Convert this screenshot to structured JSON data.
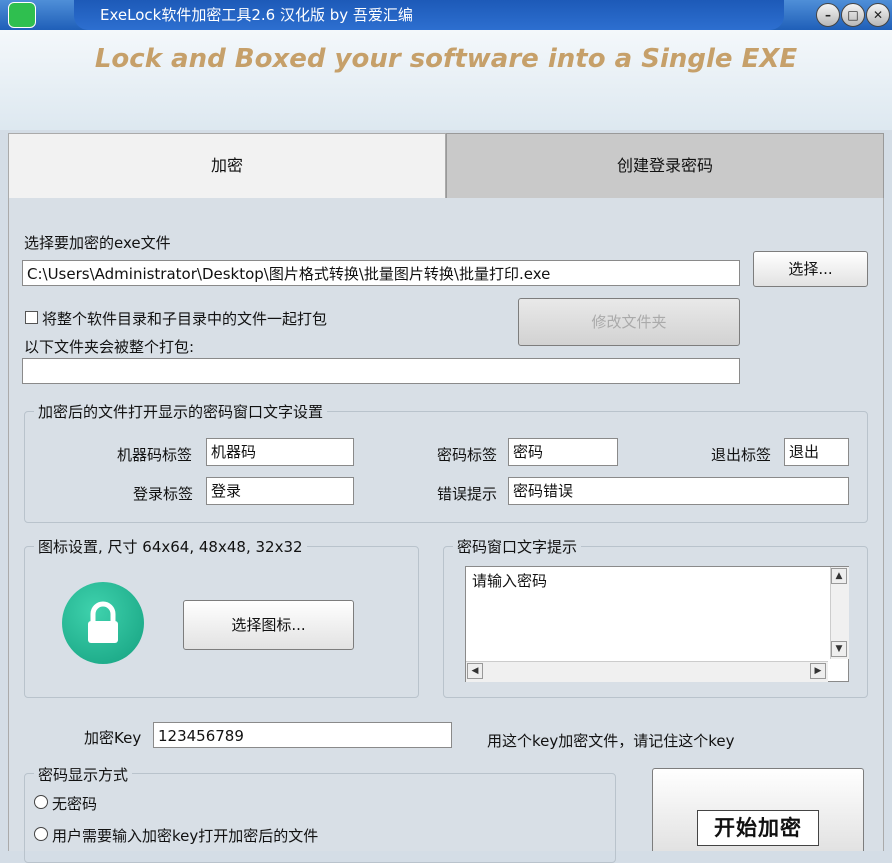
{
  "window": {
    "title": "ExeLock软件加密工具2.6 汉化版 by 吾爱汇编",
    "banner": "Lock and Boxed your software into a Single EXE"
  },
  "tabs": [
    {
      "label": "加密",
      "active": true
    },
    {
      "label": "创建登录密码",
      "active": false
    }
  ],
  "file_section": {
    "label": "选择要加密的exe文件",
    "path_value": "C:\\Users\\Administrator\\Desktop\\图片格式转换\\批量图片转换\\批量打印.exe",
    "browse_label": "选择...",
    "pack_checkbox_label": "将整个软件目录和子目录中的文件一起打包",
    "pack_checked": false,
    "modify_folder_label": "修改文件夹",
    "folder_label": "以下文件夹会被整个打包:",
    "folder_value": ""
  },
  "password_window": {
    "title": "加密后的文件打开显示的密码窗口文字设置",
    "machine_code_label": "机器码标签",
    "machine_code_value": "机器码",
    "password_label": "密码标签",
    "password_value": "密码",
    "exit_label": "退出标签",
    "exit_value": "退出",
    "login_label": "登录标签",
    "login_value": "登录",
    "error_label": "错误提示",
    "error_value": "密码错误"
  },
  "icon_settings": {
    "title": "图标设置, 尺寸 64x64, 48x48, 32x32",
    "choose_icon_label": "选择图标..."
  },
  "hint_section": {
    "title": "密码窗口文字提示",
    "text": "请输入密码"
  },
  "key_section": {
    "label": "加密Key",
    "value": "123456789",
    "note": "用这个key加密文件，请记住这个key"
  },
  "display_mode": {
    "title": "密码显示方式",
    "options": [
      {
        "label": "无密码",
        "selected": false
      },
      {
        "label": "用户需要输入加密key打开加密后的文件",
        "selected": false
      }
    ]
  },
  "start_button": {
    "label": "开始加密"
  },
  "colors": {
    "accent": "#1f5fb8",
    "banner_text": "#c6a06a",
    "lock_icon": "#1fb38f"
  }
}
